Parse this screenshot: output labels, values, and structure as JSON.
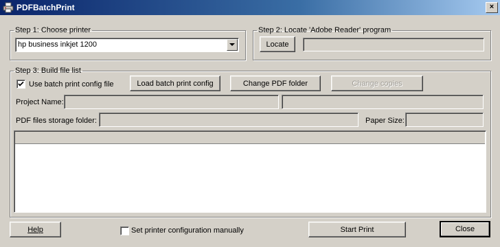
{
  "window": {
    "title": "PDFBatchPrint"
  },
  "step1": {
    "legend": "Step 1: Choose printer",
    "printer_selected": "hp business inkjet 1200"
  },
  "step2": {
    "legend": "Step 2: Locate 'Adobe Reader' program",
    "locate_label": "Locate",
    "path_value": ""
  },
  "step3": {
    "legend": "Step 3: Build file list",
    "use_config_label": "Use batch print config file",
    "use_config_checked": true,
    "load_config_label": "Load batch print config",
    "change_folder_label": "Change PDF folder",
    "change_copies_label": "Change copies",
    "project_name_label": "Project Name:",
    "project_name_value": "",
    "storage_folder_label": "PDF files storage folder:",
    "storage_folder_value": "",
    "paper_size_label": "Paper Size:",
    "paper_size_value": ""
  },
  "footer": {
    "help_label": "Help",
    "manual_config_label": "Set printer configuration manually",
    "manual_config_checked": false,
    "start_print_label": "Start Print",
    "close_label": "Close"
  },
  "icons": {
    "app": "printer-icon",
    "dropdown": "chevron-down-icon",
    "check": "checkmark-icon"
  }
}
